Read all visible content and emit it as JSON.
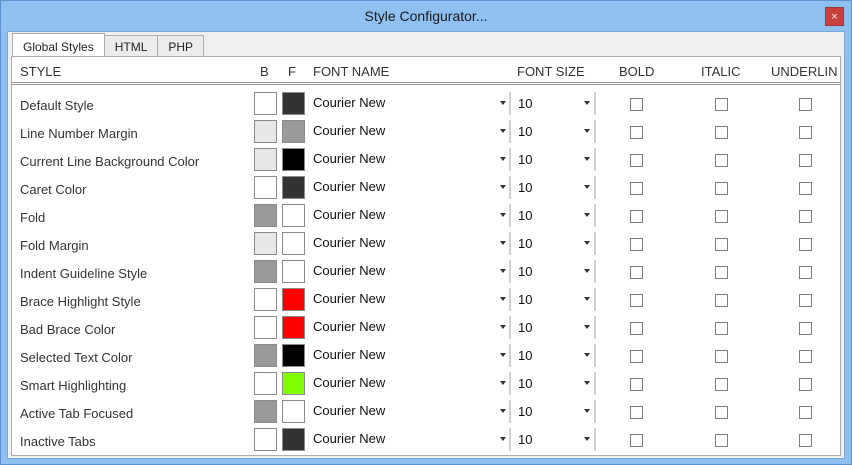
{
  "window": {
    "title": "Style Configurator...",
    "close_label": "×"
  },
  "tabs": [
    {
      "label": "Global Styles",
      "active": true
    },
    {
      "label": "HTML",
      "active": false
    },
    {
      "label": "PHP",
      "active": false
    }
  ],
  "columns": {
    "style": "STYLE",
    "b": "B",
    "f": "F",
    "font_name": "FONT NAME",
    "font_size": "FONT SIZE",
    "bold": "BOLD",
    "italic": "ITALIC",
    "underline": "UNDERLIN"
  },
  "rows": [
    {
      "label": "Default Style",
      "b": "#ffffff",
      "f": "#333333",
      "font": "Courier New",
      "size": "10"
    },
    {
      "label": "Line Number Margin",
      "b": "#e8e8e8",
      "f": "#9a9a9a",
      "font": "Courier New",
      "size": "10"
    },
    {
      "label": "Current Line Background Color",
      "b": "#e8e8e8",
      "f": "#000000",
      "font": "Courier New",
      "size": "10"
    },
    {
      "label": "Caret Color",
      "b": "#ffffff",
      "f": "#333333",
      "font": "Courier New",
      "size": "10"
    },
    {
      "label": "Fold",
      "b": "#9a9a9a",
      "f": "#ffffff",
      "font": "Courier New",
      "size": "10"
    },
    {
      "label": "Fold Margin",
      "b": "#e8e8e8",
      "f": "#ffffff",
      "font": "Courier New",
      "size": "10"
    },
    {
      "label": "Indent Guideline Style",
      "b": "#9a9a9a",
      "f": "#ffffff",
      "font": "Courier New",
      "size": "10"
    },
    {
      "label": "Brace Highlight Style",
      "b": "#ffffff",
      "f": "#ff0000",
      "font": "Courier New",
      "size": "10"
    },
    {
      "label": "Bad Brace Color",
      "b": "#ffffff",
      "f": "#ff0000",
      "font": "Courier New",
      "size": "10"
    },
    {
      "label": "Selected Text Color",
      "b": "#9a9a9a",
      "f": "#000000",
      "font": "Courier New",
      "size": "10"
    },
    {
      "label": "Smart Highlighting",
      "b": "#ffffff",
      "f": "#80ff00",
      "font": "Courier New",
      "size": "10"
    },
    {
      "label": "Active Tab Focused",
      "b": "#9a9a9a",
      "f": "#ffffff",
      "font": "Courier New",
      "size": "10"
    },
    {
      "label": "Inactive Tabs",
      "b": "#ffffff",
      "f": "#333333",
      "font": "Courier New",
      "size": "10"
    }
  ]
}
